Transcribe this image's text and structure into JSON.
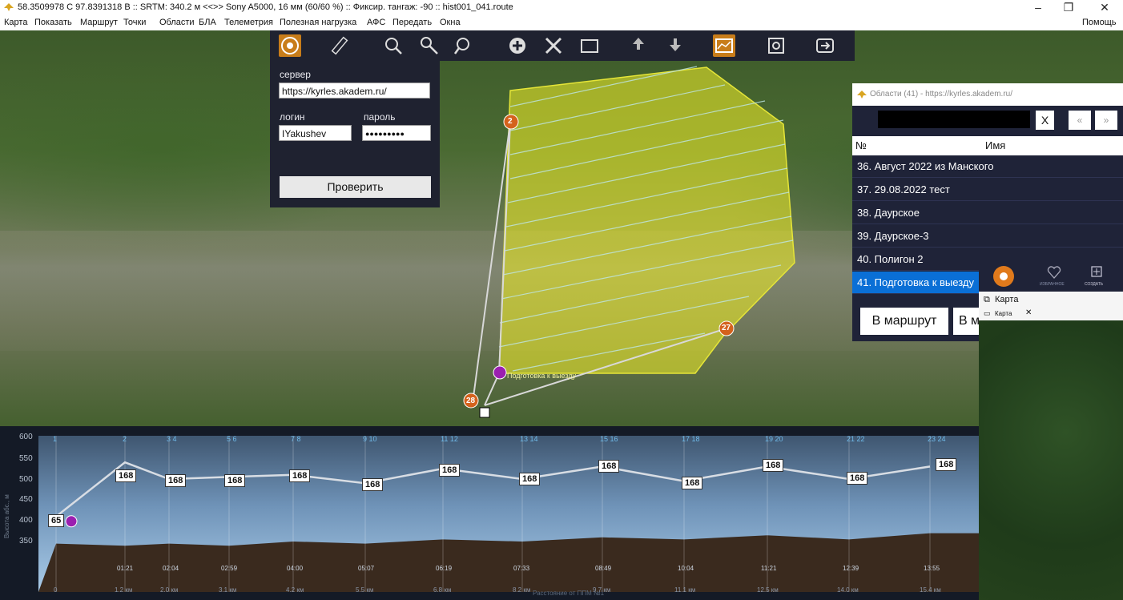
{
  "window": {
    "title": "58.3509978 С  97.8391318 В  ::  SRTM: 340.2 м   <<>>  Sony A5000, 16 мм (60/60 %)  ::  Фиксир. тангаж: -90  ::  hist001_041.route",
    "minimize": "–",
    "maximize": "❐",
    "close": "✕"
  },
  "menu": {
    "items": [
      "Карта",
      "Показать",
      "Маршрут",
      "Точки",
      "Области",
      "БЛА",
      "Телеметрия",
      "Полезная нагрузка",
      "АФС",
      "Передать",
      "Окна"
    ],
    "help": "Помощь"
  },
  "toolbar": {
    "icons": [
      "aperture-icon",
      "ruler-icon",
      "zoom-icon",
      "search-key-icon",
      "zoom-out-icon",
      "add-point-icon",
      "tools-icon",
      "photo-icon",
      "upload-icon",
      "download-icon",
      "profile-icon",
      "settings-icon",
      "exit-icon"
    ]
  },
  "login": {
    "server_label": "сервер",
    "server_value": "https://kyrles.akadem.ru/",
    "login_label": "логин",
    "login_value": "IYakushev",
    "password_label": "пароль",
    "password_value": "●●●●●●●●●",
    "check_button": "Проверить"
  },
  "areas_panel": {
    "title": "Области (41) - https://kyrles.akadem.ru/",
    "clear_button": "X",
    "prev_button": "«",
    "next_button": "»",
    "col_num": "№",
    "col_name": "Имя",
    "rows": [
      "36. Август 2022 из Манского",
      "37. 29.08.2022 тест",
      "38. Даурское",
      "39. Даурское-3",
      "40. Полигон 2",
      "41. Подготовка к выезду"
    ],
    "to_route_button": "В маршрут",
    "second_button": "В м"
  },
  "mini_window": {
    "fav_label": "ИЗБРАННОЕ",
    "create_label": "СОЗДАТЬ",
    "tab1": "Карта",
    "tab2": "Карта",
    "tab_close": "✕"
  },
  "map_markers": {
    "start": "2",
    "end": "27",
    "home": "28",
    "area_label": "Подготовка к выезду"
  },
  "profile": {
    "y_axis_label": "Высота абс., м",
    "x_axis_label": "Расстояние от ППМ №1",
    "y_ticks": [
      "600",
      "550",
      "500",
      "450",
      "400",
      "350"
    ],
    "x_ticks": [
      "0",
      "1.2 км",
      "2.0 км",
      "3.1 км",
      "4.2 км",
      "5.5 км",
      "6.8 км",
      "8.2 км",
      "9.7 км",
      "11.1 км",
      "12.5 км",
      "14.0 км",
      "15.4 км"
    ],
    "times": [
      "01:21",
      "02:04",
      "02:59",
      "04:00",
      "05:07",
      "06:19",
      "07:33",
      "08:49",
      "10:04",
      "11:21",
      "12:39",
      "13:55"
    ],
    "waypoints": [
      "1",
      "2",
      "3 4",
      "5 6",
      "7 8",
      "9 10",
      "11 12",
      "13 14",
      "15 16",
      "17 18",
      "19 20",
      "21 22",
      "23 24"
    ],
    "altitude_labels": [
      "65",
      "168",
      "168",
      "168",
      "168",
      "168",
      "168",
      "168",
      "168",
      "168",
      "168",
      "168",
      "168"
    ],
    "altitude_values": [
      65,
      168,
      168,
      168,
      168,
      168,
      168,
      168,
      168,
      168,
      168,
      168,
      168
    ],
    "route_alt_m": [
      410,
      540,
      500,
      505,
      510,
      490,
      525,
      500,
      530,
      495,
      530,
      500,
      530
    ],
    "terrain_alt_m": [
      345,
      340,
      345,
      340,
      350,
      345,
      355,
      350,
      360,
      355,
      365,
      355,
      370
    ]
  }
}
